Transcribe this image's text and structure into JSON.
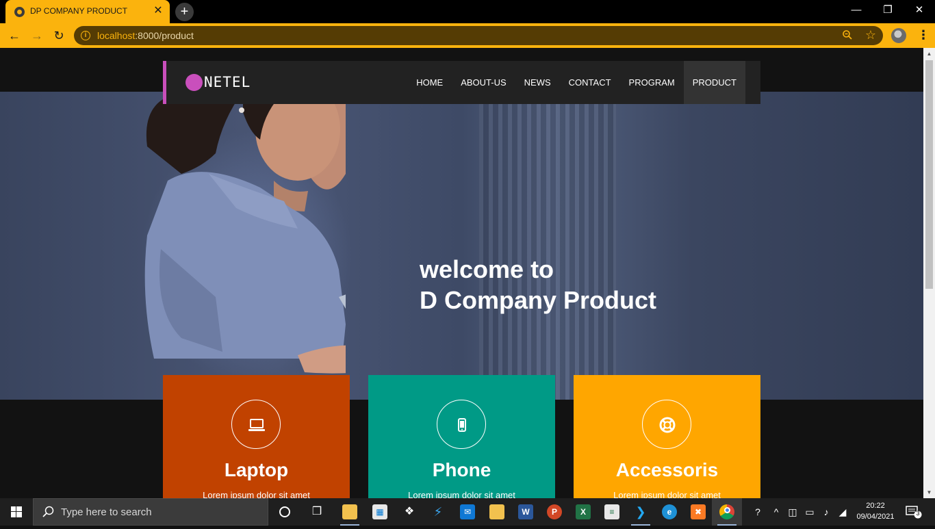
{
  "browser": {
    "tab_title": "DP COMPANY PRODUCT",
    "tab_close": "✕",
    "new_tab": "+",
    "url_host": "localhost",
    "url_path": ":8000/product",
    "window_controls": {
      "minimize": "—",
      "restore": "❐",
      "close": "✕"
    },
    "menu": "⋮"
  },
  "site": {
    "logo_text": "NETEL",
    "accent_color": "#c94fbc",
    "nav": [
      {
        "label": "HOME"
      },
      {
        "label": "ABOUT-US"
      },
      {
        "label": "NEWS"
      },
      {
        "label": "CONTACT"
      },
      {
        "label": "PROGRAM"
      },
      {
        "label": "PRODUCT",
        "active": true
      }
    ],
    "hero": {
      "line1": "welcome to",
      "line2": "D Company Product"
    },
    "cards": [
      {
        "title": "Laptop",
        "text": "Lorem ipsum dolor sit amet",
        "icon": "laptop-icon",
        "color": "#c14200"
      },
      {
        "title": "Phone",
        "text": "Lorem ipsum dolor sit amet",
        "icon": "phone-icon",
        "color": "#009a86"
      },
      {
        "title": "Accessoris",
        "text": "Lorem ipsum dolor sit amet",
        "icon": "lifebuoy-icon",
        "color": "#ffa600"
      }
    ]
  },
  "taskbar": {
    "search_placeholder": "Type here to search",
    "time": "20:22",
    "date": "09/04/2021",
    "notification_count": "3",
    "apps": [
      "cortana-icon",
      "task-view-icon",
      "file-explorer-icon",
      "store-icon",
      "dropbox-icon",
      "visual-studio-icon",
      "mail-icon",
      "app-icon",
      "word-icon",
      "powerpoint-icon",
      "excel-icon",
      "app-icon",
      "vscode-icon",
      "edge-icon",
      "xampp-icon",
      "chrome-icon"
    ]
  }
}
